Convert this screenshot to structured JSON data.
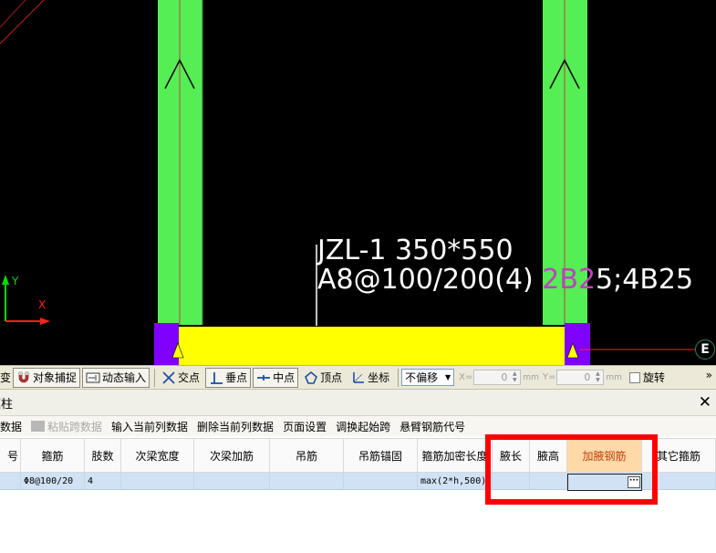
{
  "canvas": {
    "beam_label_line1": "JZL-1 350*550",
    "beam_label_line2_white": "A8@100/200(4) ",
    "beam_label_line2_magenta": "2B2",
    "beam_label_line2_rest": "5;4B25",
    "axis_y": "Y",
    "axis_x": "X",
    "grid_marker": "E",
    "colors": {
      "background": "#000000",
      "column": "#55ee55",
      "beam": "#ffff00",
      "support": "#8000ff",
      "axis_line": "#ff2020"
    }
  },
  "snap_toolbar": {
    "cut_label": "变",
    "object_snap": "对象捕捉",
    "dynamic_input": "动态输入",
    "intersection": "交点",
    "perpendicular": "垂点",
    "midpoint": "中点",
    "vertex": "顶点",
    "coordinate": "坐标",
    "offset_value": "不偏移",
    "x_label": "X=",
    "x_value": "0",
    "y_label": "Y=",
    "y_value": "0",
    "unit": "mm",
    "rotate_label": "旋转",
    "more": "»"
  },
  "panel": {
    "title": "框柱",
    "close": "✕"
  },
  "grid_toolbar": {
    "items": [
      "跨数据",
      "粘贴跨数据",
      "输入当前列数据",
      "删除当前列数据",
      "页面设置",
      "调换起始跨",
      "悬臂钢筋代号"
    ]
  },
  "grid": {
    "columns": [
      "号",
      "箍筋",
      "肢数",
      "次梁宽度",
      "次梁加筋",
      "吊筋",
      "吊筋锚固",
      "箍筋加密长度",
      "腋长",
      "腋高",
      "加腋钢筋",
      "其它箍筋"
    ],
    "active_column": "加腋钢筋",
    "row": [
      "",
      "Φ8@100/20",
      "4",
      "",
      "",
      "",
      "",
      "max(2*h,500)",
      "",
      "",
      "",
      ""
    ],
    "ellipsis": "···"
  }
}
